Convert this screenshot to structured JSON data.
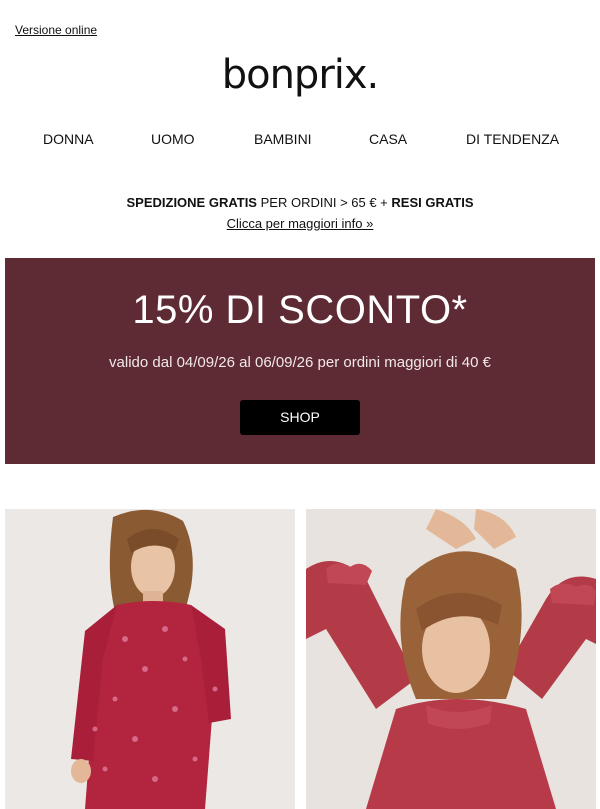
{
  "header": {
    "online_link": "Versione online",
    "logo_text": "bonprix."
  },
  "nav": {
    "items": [
      "DONNA",
      "UOMO",
      "BAMBINI",
      "CASA",
      "DI TENDENZA"
    ]
  },
  "shipping": {
    "part1_bold": "SPEDIZIONE GRATIS",
    "part2": "PER ORDINI > 65 € +",
    "part3_bold": "RESI GRATIS",
    "info_link": "Clicca per maggiori info »"
  },
  "banner": {
    "headline": "15% DI SCONTO*",
    "subtitle": "valido dal 04/09/26 al 06/09/26 per ordini maggiori di 40 €",
    "button": "SHOP",
    "bg_color": "#5e2a33"
  },
  "products": [
    {
      "name": "photo-woman-floral-dress"
    },
    {
      "name": "photo-woman-red-blouse"
    }
  ]
}
